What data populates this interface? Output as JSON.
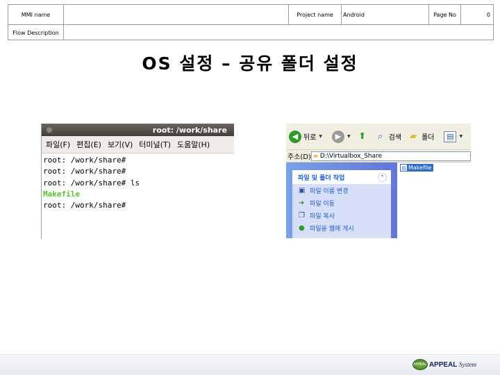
{
  "header": {
    "mmi_name_label": "MMI name",
    "mmi_name_value": "",
    "project_name_label": "Project name",
    "project_name_value": "Android",
    "page_no_label": "Page No",
    "page_no_value": "0",
    "flow_description_label": "Flow Description",
    "flow_description_value": ""
  },
  "title": "OS 설정 – 공유 폴더 설정",
  "terminal": {
    "title": "root: /work/share",
    "menu": [
      "파일(F)",
      "편집(E)",
      "보기(V)",
      "터미널(T)",
      "도움말(H)"
    ],
    "lines": [
      "root: /work/share#",
      "root: /work/share#",
      "root: /work/share# ls",
      "Makefile",
      "root: /work/share#"
    ]
  },
  "explorer": {
    "toolbar": {
      "back_label": "뒤로",
      "search_label": "검색",
      "folders_label": "폴더"
    },
    "address_label": "주소(D)",
    "address_value": "D:\\Virtualbox_Share",
    "task_panel_title": "파일 및 폴더 작업",
    "tasks": [
      "파일 이름 변경",
      "파일 이동",
      "파일 복사",
      "파일을 웹에 게시"
    ],
    "file_name": "Makefile"
  },
  "footer": {
    "emblem_text": "APPEAL",
    "brand_bold": "APPEAL",
    "brand_rest": "System"
  }
}
